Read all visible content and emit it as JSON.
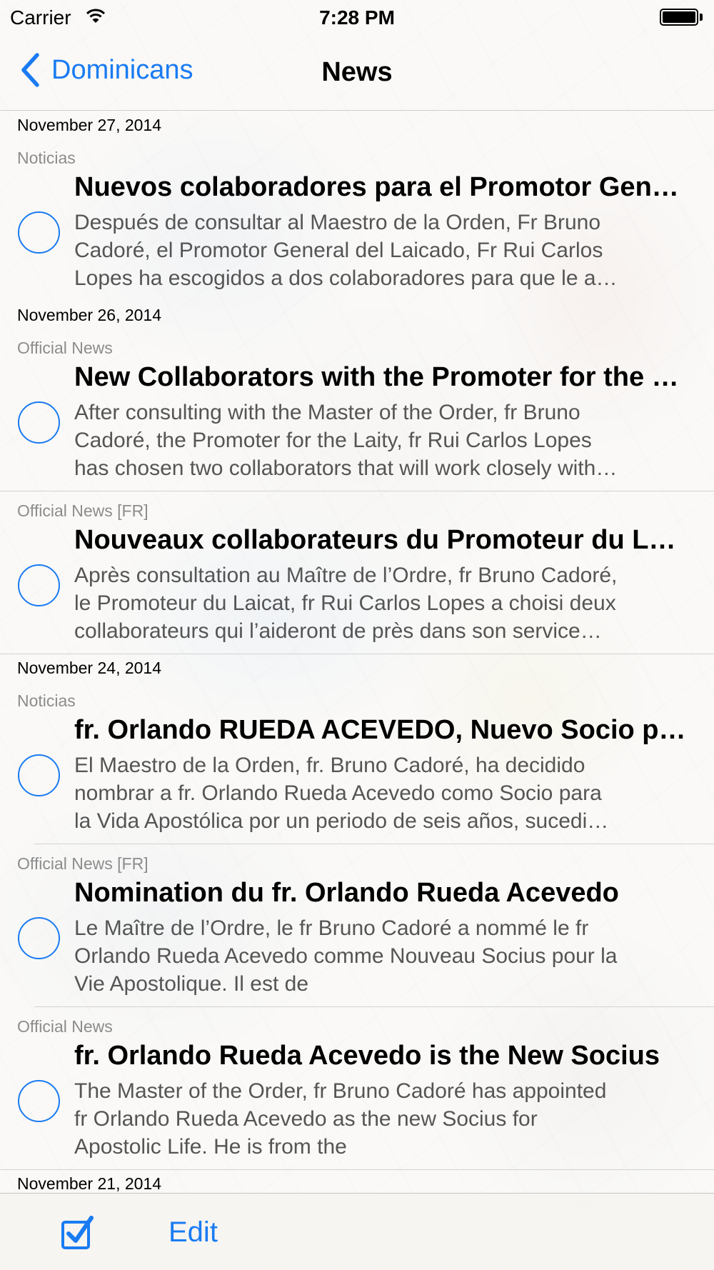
{
  "status_bar": {
    "carrier": "Carrier",
    "time": "7:28 PM",
    "icons": [
      "wifi-icon",
      "battery-icon"
    ]
  },
  "nav": {
    "back_label": "Dominicans",
    "title": "News"
  },
  "sections": [
    {
      "date": "November 27, 2014",
      "items": [
        {
          "source": "Noticias",
          "headline": "Nuevos colaboradores para el Promotor General del Laicado",
          "summary": [
            "Después de consultar al Maestro de la Orden, Fr Bruno",
            "Cadoré, el Promotor General del Laicado, Fr Rui Carlos",
            "Lopes ha escogidos a dos colaboradores para que le a…"
          ]
        }
      ]
    },
    {
      "date": "November 26, 2014",
      "items": [
        {
          "source": "Official News",
          "headline": "New Collaborators with the Promoter for the Laity",
          "summary": [
            "After consulting with the Master of the Order, fr Bruno",
            "Cadoré, the Promoter for the Laity, fr Rui Carlos Lopes",
            "has chosen two collaborators that will work closely with…"
          ]
        },
        {
          "source": "Official News [FR]",
          "headline": "Nouveaux collaborateurs du Promoteur du Laicat",
          "summary": [
            "Après consultation au Maître de l’Ordre, fr Bruno Cadoré,",
            "le Promoteur du Laicat, fr Rui Carlos Lopes a choisi deux",
            "collaborateurs qui l’aideront de près dans son service…"
          ]
        }
      ]
    },
    {
      "date": "November 24, 2014",
      "items": [
        {
          "source": "Noticias",
          "headline": "fr. Orlando RUEDA ACEVEDO, Nuevo Socio para la Vida Apostólica",
          "summary": [
            "El Maestro de la Orden, fr. Bruno Cadoré, ha decidido",
            "nombrar a fr. Orlando Rueda Acevedo como Socio para",
            "la Vida Apostólica por un periodo de seis años, sucedi…"
          ]
        },
        {
          "source": "Official News [FR]",
          "headline": "Nomination du fr. Orlando Rueda Acevedo",
          "summary": [
            "Le Maître de l’Ordre, le fr Bruno Cadoré a nommé le fr",
            "Orlando Rueda Acevedo comme Nouveau Socius pour la",
            "Vie Apostolique. Il est de"
          ]
        },
        {
          "source": "Official News",
          "headline": "fr. Orlando Rueda Acevedo is the New Socius",
          "summary": [
            "The Master of the Order, fr Bruno Cadoré has appointed",
            "fr Orlando Rueda Acevedo as the new Socius for",
            "Apostolic Life. He is from the"
          ]
        }
      ]
    },
    {
      "date": "November 21, 2014",
      "items": []
    }
  ],
  "toolbar": {
    "edit_label": "Edit",
    "check_icon": "checkbox-checked-icon"
  },
  "colors": {
    "accent": "#1a7bf2",
    "source_gray": "#8c8c8c",
    "summary_gray": "#555555"
  }
}
